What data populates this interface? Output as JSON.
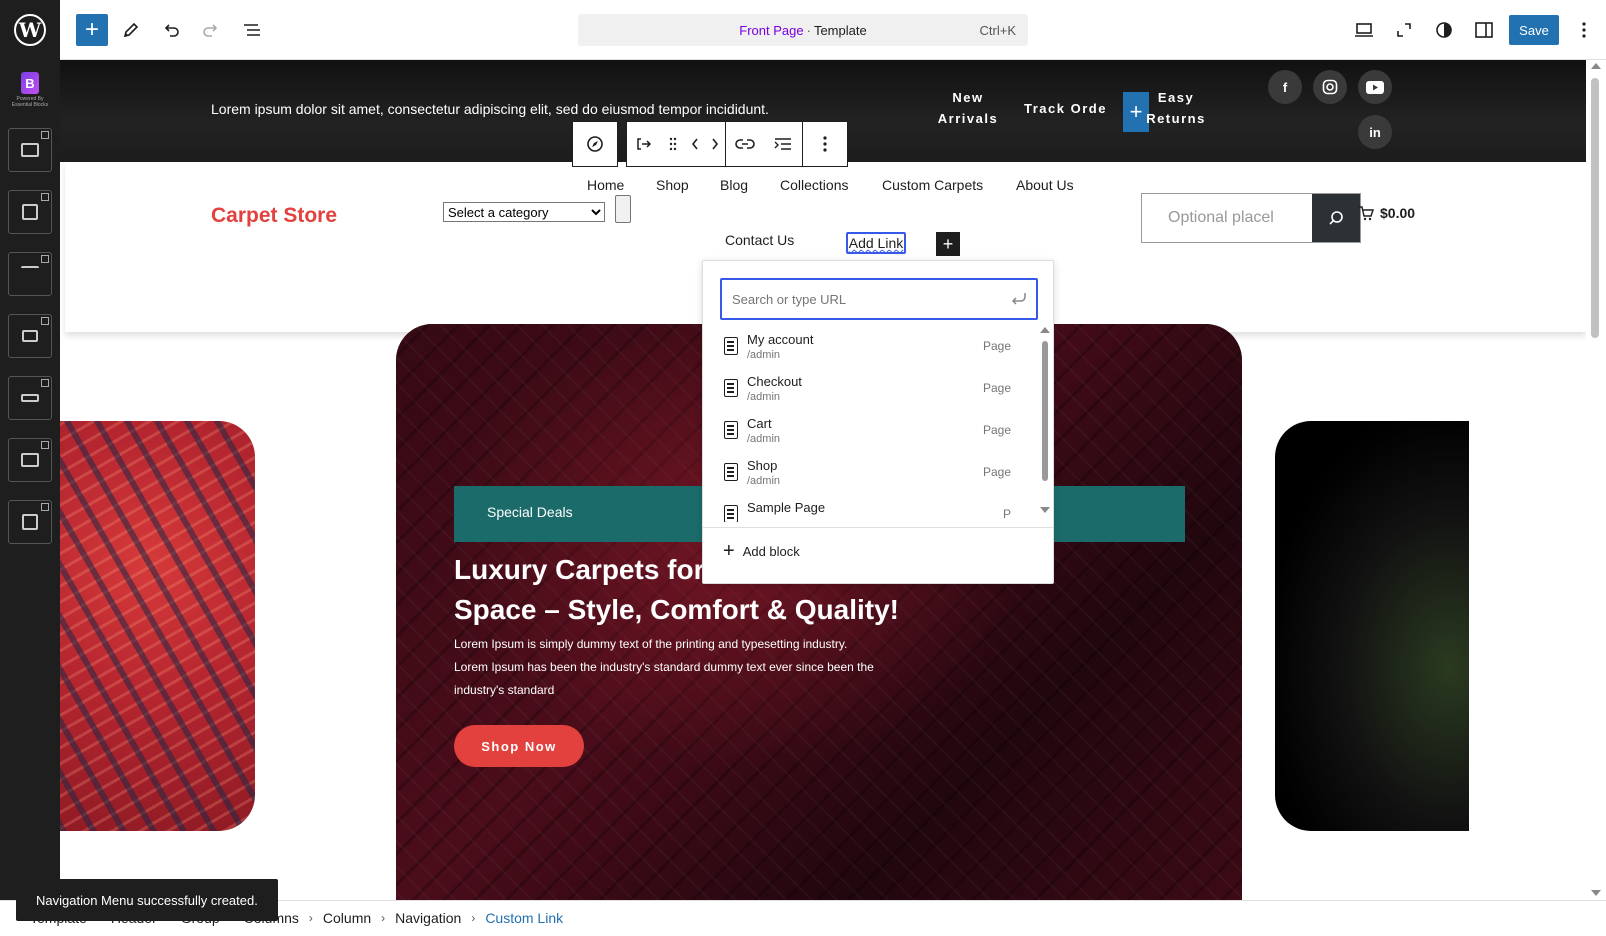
{
  "topbar": {
    "doc_kind": "Front Page",
    "doc_separator": "·",
    "doc_type": "Template",
    "shortcut": "Ctrl+K",
    "save_label": "Save"
  },
  "sidebar": {
    "brand_text": "Powered By Essential Blocks"
  },
  "top_strip": {
    "promo": "Lorem ipsum dolor sit amet, consectetur adipiscing elit, sed do eiusmod tempor incididunt.",
    "links": [
      {
        "line1": "New",
        "line2": "Arrivals"
      },
      {
        "line1": "Track Orde",
        "line2": ""
      },
      {
        "line1": "Easy",
        "line2": "Returns"
      }
    ],
    "socials": [
      "facebook-icon",
      "instagram-icon",
      "youtube-icon",
      "linkedin-icon"
    ]
  },
  "header": {
    "site_title": "Carpet Store",
    "category_select": "Select a category",
    "nav": [
      "Home",
      "Shop",
      "Blog",
      "Collections",
      "Custom Carpets",
      "About Us",
      "Contact Us"
    ],
    "add_link": "Add Link",
    "search_placeholder": "Optional placel",
    "cart_total": "$0.00"
  },
  "hero": {
    "deals_label": "Special Deals",
    "title": "Luxury Carpets for Every Space – Style, Comfort & Quality!",
    "title_visible": "Luxury Carpets for",
    "title_line2": "Space – Style, Comfort & Quality!",
    "text": "Lorem Ipsum is simply dummy text of the printing and typesetting industry. Lorem Ipsum has been the industry's standard dummy text  ever since been the industry's standard",
    "cta": "Shop Now"
  },
  "link_popover": {
    "placeholder": "Search or type URL",
    "suggestions": [
      {
        "title": "My account",
        "url": "/admin",
        "type": "Page"
      },
      {
        "title": "Checkout",
        "url": "/admin",
        "type": "Page"
      },
      {
        "title": "Cart",
        "url": "/admin",
        "type": "Page"
      },
      {
        "title": "Shop",
        "url": "/admin",
        "type": "Page"
      },
      {
        "title": "Sample Page",
        "url": "",
        "type": "P"
      }
    ],
    "add_block": "Add block"
  },
  "breadcrumb": [
    "Template",
    "Header",
    "Group",
    "Columns",
    "Column",
    "Navigation",
    "Custom Link"
  ],
  "snackbar": "Navigation Menu successfully created.",
  "colors": {
    "accent": "#2271b1",
    "brand_red": "#e2413d",
    "teal": "#1c6b6b",
    "focus": "#3858e9"
  }
}
